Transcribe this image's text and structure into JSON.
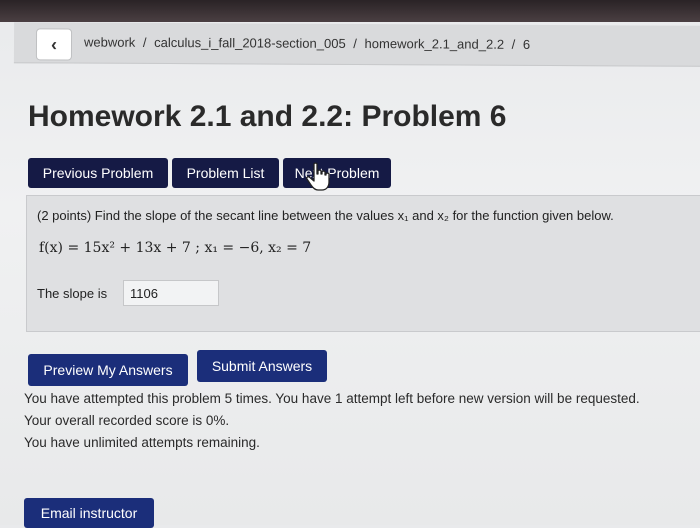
{
  "breadcrumb": {
    "items": [
      "webwork",
      "calculus_i_fall_2018-section_005",
      "homework_2.1_and_2.2",
      "6"
    ],
    "separator": "/"
  },
  "page": {
    "title": "Homework 2.1 and 2.2: Problem 6"
  },
  "nav": {
    "previous_label": "Previous Problem",
    "list_label": "Problem List",
    "next_label": "Next Problem"
  },
  "problem": {
    "prompt": "(2 points) Find the slope of the secant line between the values x₁ and x₂ for the function given below.",
    "equation": "f(x) = 15x² + 13x + 7 ; x₁ = −6, x₂ = 7",
    "answer_label": "The slope is",
    "answer_value": "1106"
  },
  "actions": {
    "preview_label": "Preview My Answers",
    "submit_label": "Submit Answers"
  },
  "status": {
    "line1": "You have attempted this problem 5 times. You have 1 attempt left before new version will be requested.",
    "line2": "Your overall recorded score is 0%.",
    "line3": "You have unlimited attempts remaining."
  },
  "footer": {
    "email_label": "Email instructor"
  },
  "colors": {
    "nav_button": "#151a45",
    "action_button": "#1b2e7a"
  },
  "icons": {
    "back": "chevron-left-icon",
    "cursor": "hand-pointer-icon"
  }
}
